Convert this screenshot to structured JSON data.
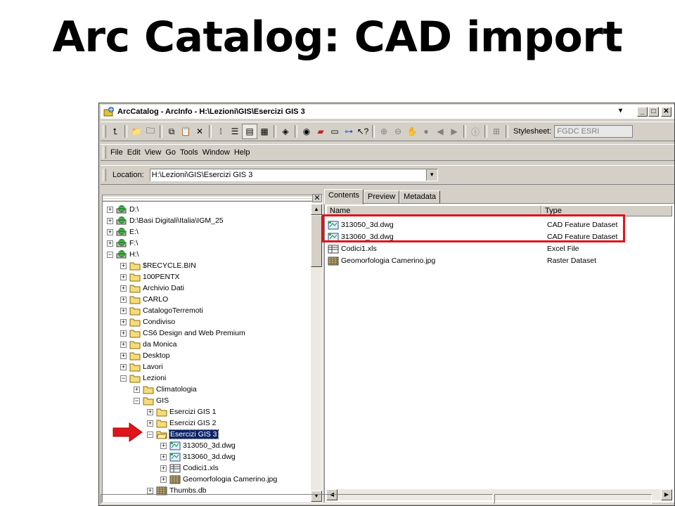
{
  "slide": {
    "title": "Arc Catalog: CAD import"
  },
  "window": {
    "title": "ArcCatalog - ArcInfo - H:\\Lezioni\\GIS\\Esercizi GIS 3",
    "controls": [
      "▾",
      "_",
      "□",
      "✕"
    ]
  },
  "toolbar": {
    "stylesheet_label": "Stylesheet:",
    "stylesheet_value": "FGDC ESRI"
  },
  "menu": [
    "File",
    "Edit",
    "View",
    "Go",
    "Tools",
    "Window",
    "Help"
  ],
  "location": {
    "label": "Location:",
    "value": "H:\\Lezioni\\GIS\\Esercizi GIS 3"
  },
  "tree": [
    {
      "label": "D:\\",
      "icon": "drive-icon",
      "level": 0,
      "expander": "+"
    },
    {
      "label": "D:\\Basi Digitali\\Italia\\IGM_25",
      "icon": "drive-icon",
      "level": 0,
      "expander": "+"
    },
    {
      "label": "E:\\",
      "icon": "drive-icon",
      "level": 0,
      "expander": "+"
    },
    {
      "label": "F:\\",
      "icon": "drive-icon",
      "level": 0,
      "expander": "+"
    },
    {
      "label": "H:\\",
      "icon": "drive-icon",
      "level": 0,
      "expander": "−"
    },
    {
      "label": "$RECYCLE.BIN",
      "icon": "folder-icon",
      "level": 1,
      "expander": "+"
    },
    {
      "label": "100PENTX",
      "icon": "folder-icon",
      "level": 1,
      "expander": "+"
    },
    {
      "label": "Archivio Dati",
      "icon": "folder-icon",
      "level": 1,
      "expander": "+"
    },
    {
      "label": "CARLO",
      "icon": "folder-icon",
      "level": 1,
      "expander": "+"
    },
    {
      "label": "CatalogoTerremoti",
      "icon": "folder-icon",
      "level": 1,
      "expander": "+"
    },
    {
      "label": "Condiviso",
      "icon": "folder-icon",
      "level": 1,
      "expander": "+"
    },
    {
      "label": "CS6 Design and Web Premium",
      "icon": "folder-icon",
      "level": 1,
      "expander": "+"
    },
    {
      "label": "da Monica",
      "icon": "folder-icon",
      "level": 1,
      "expander": "+"
    },
    {
      "label": "Desktop",
      "icon": "folder-icon",
      "level": 1,
      "expander": "+"
    },
    {
      "label": "Lavori",
      "icon": "folder-icon",
      "level": 1,
      "expander": "+"
    },
    {
      "label": "Lezioni",
      "icon": "folder-icon",
      "level": 1,
      "expander": "−"
    },
    {
      "label": "Climatologia",
      "icon": "folder-icon",
      "level": 2,
      "expander": "+"
    },
    {
      "label": "GIS",
      "icon": "folder-icon",
      "level": 2,
      "expander": "−"
    },
    {
      "label": "Esercizi GIS 1",
      "icon": "folder-icon",
      "level": 3,
      "expander": "+"
    },
    {
      "label": "Esercizi GIS 2",
      "icon": "folder-icon",
      "level": 3,
      "expander": "+"
    },
    {
      "label": "Esercizi GIS 3",
      "icon": "folder-open-icon",
      "level": 3,
      "expander": "−",
      "selected": true
    },
    {
      "label": "313050_3d.dwg",
      "icon": "cad-dataset-icon",
      "level": 4,
      "expander": "+"
    },
    {
      "label": "313060_3d.dwg",
      "icon": "cad-dataset-icon",
      "level": 4,
      "expander": "+"
    },
    {
      "label": "Codici1.xls",
      "icon": "table-icon",
      "level": 4,
      "expander": "+"
    },
    {
      "label": "Geomorfologia Camerino.jpg",
      "icon": "raster-icon",
      "level": 4,
      "expander": "+"
    },
    {
      "label": "Thumbs.db",
      "icon": "raster-icon",
      "level": 3,
      "expander": "+"
    }
  ],
  "tabs": [
    "Contents",
    "Preview",
    "Metadata"
  ],
  "contents": {
    "columns": [
      "Name",
      "Type"
    ],
    "rows": [
      {
        "name": "313050_3d.dwg",
        "type": "CAD Feature Dataset",
        "icon": "cad-dataset-icon"
      },
      {
        "name": "313060_3d.dwg",
        "type": "CAD Feature Dataset",
        "icon": "cad-dataset-icon"
      },
      {
        "name": "Codici1.xls",
        "type": "Excel File",
        "icon": "table-icon"
      },
      {
        "name": "Geomorfologia Camerino.jpg",
        "type": "Raster Dataset",
        "icon": "raster-icon"
      }
    ]
  },
  "colors": {
    "highlight_box": "#e0141b",
    "arrow": "#e0141b",
    "selection": "#0a246a"
  }
}
